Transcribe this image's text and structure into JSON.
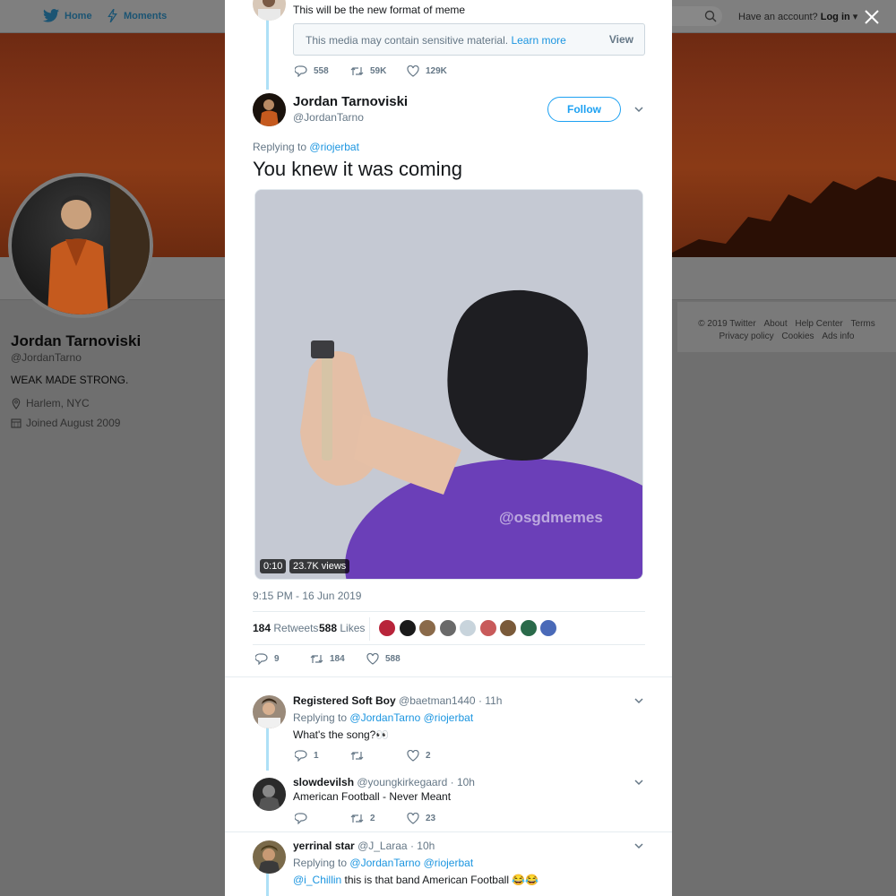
{
  "nav": {
    "home": "Home",
    "moments": "Moments",
    "login_prefix": "Have an account?",
    "login": "Log in"
  },
  "profile": {
    "name": "Jordan Tarnoviski",
    "handle": "@JordanTarno",
    "bio": "WEAK MADE STRONG.",
    "location": "Harlem, NYC",
    "joined": "Joined August 2009"
  },
  "footer": {
    "row1": [
      "© 2019 Twitter",
      "About",
      "Help Center",
      "Terms"
    ],
    "row2": [
      "Privacy policy",
      "Cookies",
      "Ads info"
    ]
  },
  "previous_tweet": {
    "text": "This will be the new format of meme",
    "sensitive_notice": "This media may contain sensitive material.",
    "learn_more": "Learn more",
    "view": "View",
    "replies": "558",
    "retweets": "59K",
    "likes": "129K"
  },
  "tweet": {
    "name": "Jordan Tarnoviski",
    "handle": "@JordanTarno",
    "follow": "Follow",
    "replying_prefix": "Replying to",
    "replying_to": "@riojerbat",
    "text": "You knew it was coming",
    "video_duration": "0:10",
    "video_views": "23.7K views",
    "watermark": "@osgdmemes",
    "timestamp": "9:15 PM - 16 Jun 2019",
    "retweets_count": "184",
    "retweets_label": "Retweets",
    "likes_count": "588",
    "likes_label": "Likes",
    "action_replies": "9",
    "action_retweets": "184",
    "action_likes": "588",
    "liker_colors": [
      "#b8243a",
      "#1a1a1a",
      "#8a6a4a",
      "#6a6a6a",
      "#c8d4dc",
      "#c85a5a",
      "#7a5a3a",
      "#2a6a4a",
      "#4a6ab8"
    ]
  },
  "replies": [
    {
      "name": "Registered Soft Boy",
      "handle": "@baetman1440",
      "time": "· 11h",
      "replying_prefix": "Replying to",
      "replying_to": "@JordanTarno @riojerbat",
      "text": "What's the song?👀",
      "replies": "1",
      "retweets": "",
      "likes": "2"
    },
    {
      "name": "slowdevilsh",
      "handle": "@youngkirkegaard",
      "time": "· 10h",
      "text": "American Football - Never Meant",
      "replies": "",
      "retweets": "2",
      "likes": "23"
    },
    {
      "name": "yerrinal star",
      "handle": "@J_Laraa",
      "time": "· 10h",
      "replying_prefix": "Replying to",
      "replying_to": "@JordanTarno @riojerbat",
      "mention": "@i_Chillin",
      "text": "this is that band American Football 😂😂"
    }
  ]
}
